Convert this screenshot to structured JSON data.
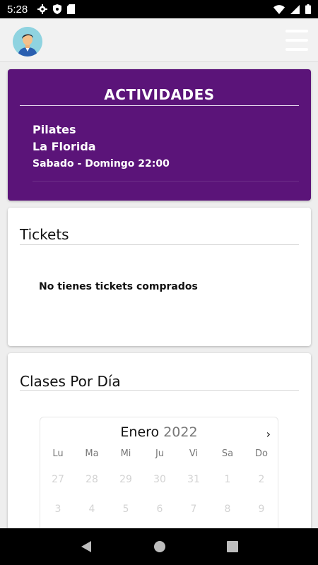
{
  "status_bar": {
    "time": "5:28",
    "icons_left": [
      "gear-icon",
      "shield-icon",
      "sd-card-icon"
    ],
    "icons_right": [
      "wifi-icon",
      "signal-icon",
      "battery-icon"
    ]
  },
  "header": {
    "avatar": "user-avatar",
    "menu": "hamburger-menu-icon"
  },
  "activities": {
    "title": "ACTIVIDADES",
    "name": "Pilates",
    "location": "La Florida",
    "schedule": "Sabado - Domingo 22:00",
    "background": "#5b1479"
  },
  "tickets": {
    "title": "Tickets",
    "empty_message": "No tienes tickets comprados"
  },
  "classes": {
    "title": "Clases Por Día",
    "calendar": {
      "month": "Enero",
      "year": "2022",
      "next": "›",
      "weekdays": [
        "Lu",
        "Ma",
        "Mi",
        "Ju",
        "Vi",
        "Sa",
        "Do"
      ],
      "rows": [
        [
          "27",
          "28",
          "29",
          "30",
          "31",
          "1",
          "2"
        ],
        [
          "3",
          "4",
          "5",
          "6",
          "7",
          "8",
          "9"
        ]
      ]
    }
  },
  "nav": {
    "back": "back-icon",
    "home": "home-icon",
    "recents": "recents-icon"
  }
}
